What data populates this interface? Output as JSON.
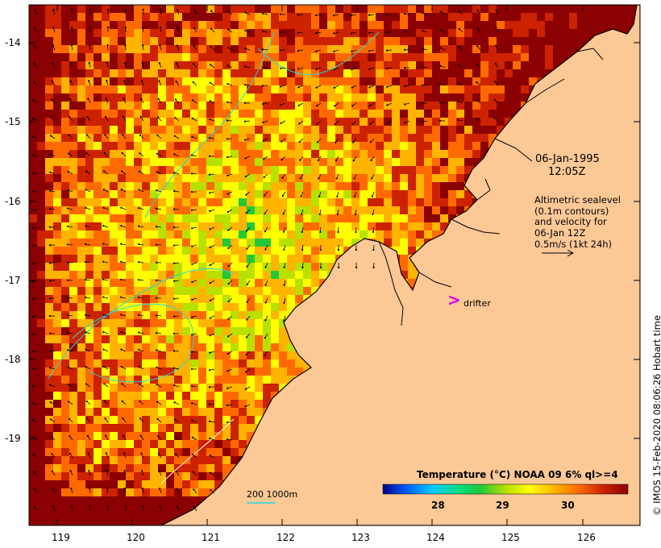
{
  "map": {
    "latitude_labels": [
      "-14",
      "-15",
      "-16",
      "-17",
      "-18",
      "-19"
    ],
    "longitude_labels": [
      "119",
      "120",
      "121",
      "122",
      "123",
      "124",
      "125",
      "126"
    ],
    "date": "06-Jan-1995",
    "time": "12:05Z",
    "altimetry_note": [
      "Altimetric sealevel",
      "(0.1m contours)",
      "and velocity for",
      "06-Jan 12Z",
      "0.5m/s (1kt 24h)"
    ],
    "drifter_label": "drifter",
    "drifter_symbol": ">",
    "colorbar": {
      "title": "Temperature (°C) NOAA 09 6% ql>=4",
      "ticks": [
        "28",
        "29",
        "30"
      ],
      "colors": [
        "#00008b",
        "#0060ff",
        "#00c8ff",
        "#00e08a",
        "#22c83a",
        "#b8e000",
        "#ffff00",
        "#ffb400",
        "#ff6a00",
        "#cc2200",
        "#8b0000"
      ]
    },
    "bathymetry_scale": "200  1000m",
    "credit": "© IMOS 15-Feb-2020 08:06:26 Hobart time",
    "colors": {
      "land": "#fcc896",
      "coastline": "#000000",
      "contour": "#20d8e0",
      "drifter": "#e400e4"
    }
  }
}
